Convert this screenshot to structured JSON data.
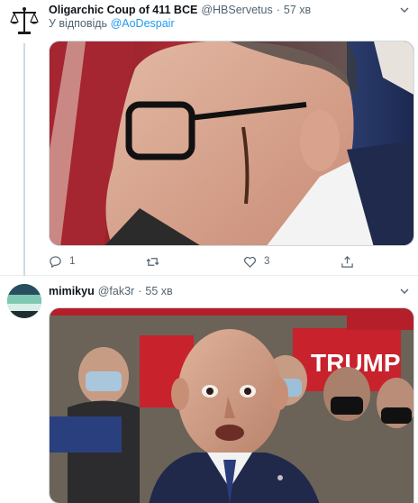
{
  "tweets": [
    {
      "display_name": "Oligarchic Coup of 411 BCE",
      "handle": "@HBServetus",
      "separator": "·",
      "time": "57 хв",
      "reply_prefix": "У відповідь",
      "reply_mention": "@AoDespair",
      "avatar_icon": "scales-of-justice-icon",
      "media_description_icon": "photo",
      "actions": {
        "reply_count": "1",
        "retweet_count": "",
        "like_count": "3"
      }
    },
    {
      "display_name": "mimikyu",
      "handle": "@fak3r",
      "separator": "·",
      "time": "55 хв",
      "avatar_icon": "landscape-avatar-icon",
      "media_banner": "TRUMP"
    }
  ],
  "colors": {
    "text_primary": "#0f1419",
    "text_secondary": "#536471",
    "link": "#1d9bf0",
    "border": "#cfd9de"
  }
}
